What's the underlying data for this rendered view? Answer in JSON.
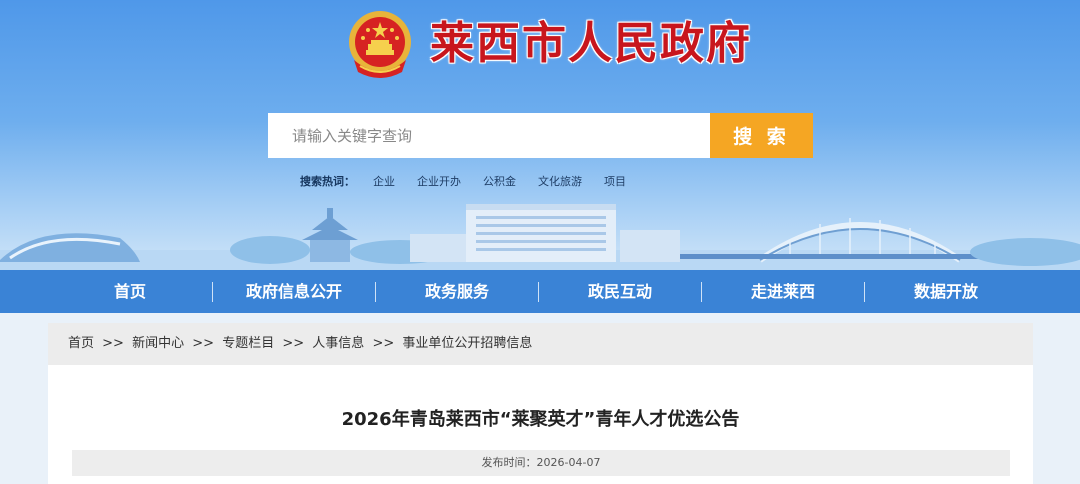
{
  "header": {
    "site_title": "莱西市人民政府",
    "emblem_icon": "national-emblem-icon"
  },
  "search": {
    "placeholder": "请输入关键字查询",
    "button_label": "搜 索",
    "hot_label": "搜索热词：",
    "hot_terms": [
      "企业",
      "企业开办",
      "公积金",
      "文化旅游",
      "项目"
    ]
  },
  "nav": {
    "items": [
      "首页",
      "政府信息公开",
      "政务服务",
      "政民互动",
      "走进莱西",
      "数据开放"
    ]
  },
  "breadcrumb": {
    "items": [
      "首页",
      "新闻中心",
      "专题栏目",
      "人事信息",
      "事业单位公开招聘信息"
    ],
    "separator": ">>"
  },
  "article": {
    "title": "2026年青岛莱西市“莱聚英才”青年人才优选公告",
    "publish_label": "发布时间：2026-04-07"
  },
  "colors": {
    "title_red": "#c8161d",
    "nav_blue": "#3a83d6",
    "search_orange": "#f5a623"
  }
}
